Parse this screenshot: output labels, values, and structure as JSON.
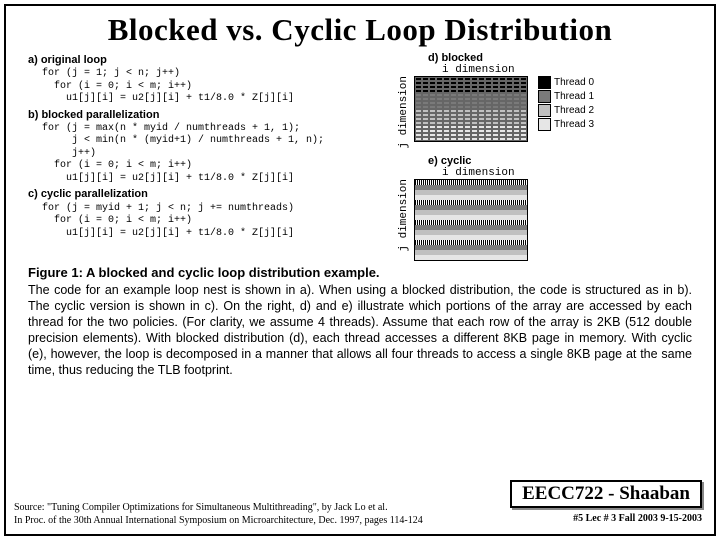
{
  "title": "Blocked vs.  Cyclic Loop Distribution",
  "code": {
    "a_label": "a) original loop",
    "a_code": "for (j = 1; j < n; j++)\n  for (i = 0; i < m; i++)\n    u1[j][i] = u2[j][i] + t1/8.0 * Z[j][i]",
    "b_label": "b) blocked parallelization",
    "b_code": "for (j = max(n * myid / numthreads + 1, 1);\n     j < min(n * (myid+1) / numthreads + 1, n);\n     j++)\n  for (i = 0; i < m; i++)\n    u1[j][i] = u2[j][i] + t1/8.0 * Z[j][i]",
    "c_label": "c) cyclic parallelization",
    "c_code": "for (j = myid + 1; j < n; j += numthreads)\n  for (i = 0; i < m; i++)\n    u1[j][i] = u2[j][i] + t1/8.0 * Z[j][i]"
  },
  "diag": {
    "d_label": "d) blocked",
    "e_label": "e) cyclic",
    "idim": "i dimension",
    "jdim": "j dimension",
    "legend": [
      "Thread 0",
      "Thread 1",
      "Thread 2",
      "Thread 3"
    ]
  },
  "colors": {
    "t0": "#000000",
    "t1": "#7a7a7a",
    "t2": "#c0c0c0",
    "t3": "#e6e6e6"
  },
  "figcap": "Figure 1: A blocked and cyclic loop distribution example.",
  "caption": "The code for an example loop nest is shown in a). When using a blocked distribution, the code is structured as in b). The cyclic version is shown in c). On the right, d) and e) illustrate which portions of the array are accessed by each thread for the two policies. (For clarity, we assume 4 threads). Assume that each row of the array is 2KB (512 double precision elements). With blocked distribution (d), each thread accesses a different 8KB page in memory. With cyclic (e), however, the loop is decomposed in a manner that allows all four threads to access a single 8KB page at the same time, thus reducing the TLB footprint.",
  "source1": "Source: \"Tuning Compiler Optimizations for Simultaneous Multithreading\", by Jack Lo et al.",
  "source2": "In Proc. of the 30th Annual International Symposium on Microarchitecture, Dec. 1997, pages 114-124",
  "course": "EECC722 - Shaaban",
  "footer": "#5   Lec # 3   Fall 2003  9-15-2003"
}
